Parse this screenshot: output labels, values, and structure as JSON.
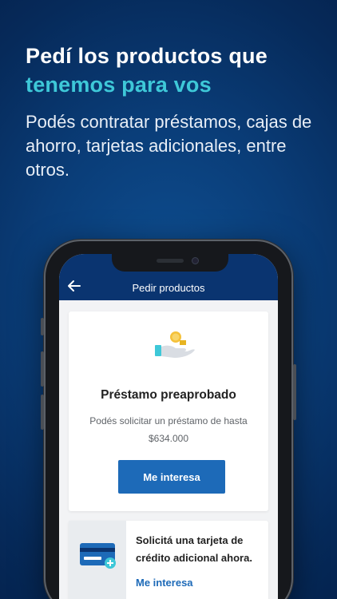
{
  "promo": {
    "headline_line1": "Pedí los productos que",
    "headline_line2": "tenemos para vos",
    "subtitle": "Podés contratar préstamos, cajas de ahorro, tarjetas adicionales, entre otros."
  },
  "app": {
    "title": "Pedir productos",
    "back_icon": "arrow-left-icon"
  },
  "loan_card": {
    "icon": "hand-coin-icon",
    "title": "Préstamo preaprobado",
    "description": "Podés solicitar un préstamo de hasta $634.000",
    "button_label": "Me interesa"
  },
  "credit_card_offer": {
    "icon": "credit-card-plus-icon",
    "text": "Solicitá una tarjeta de crédito adicional ahora.",
    "link_label": "Me interesa"
  },
  "colors": {
    "accent": "#3ec8d8",
    "primary_button": "#1d6ab8",
    "app_bar": "#0a3470"
  }
}
